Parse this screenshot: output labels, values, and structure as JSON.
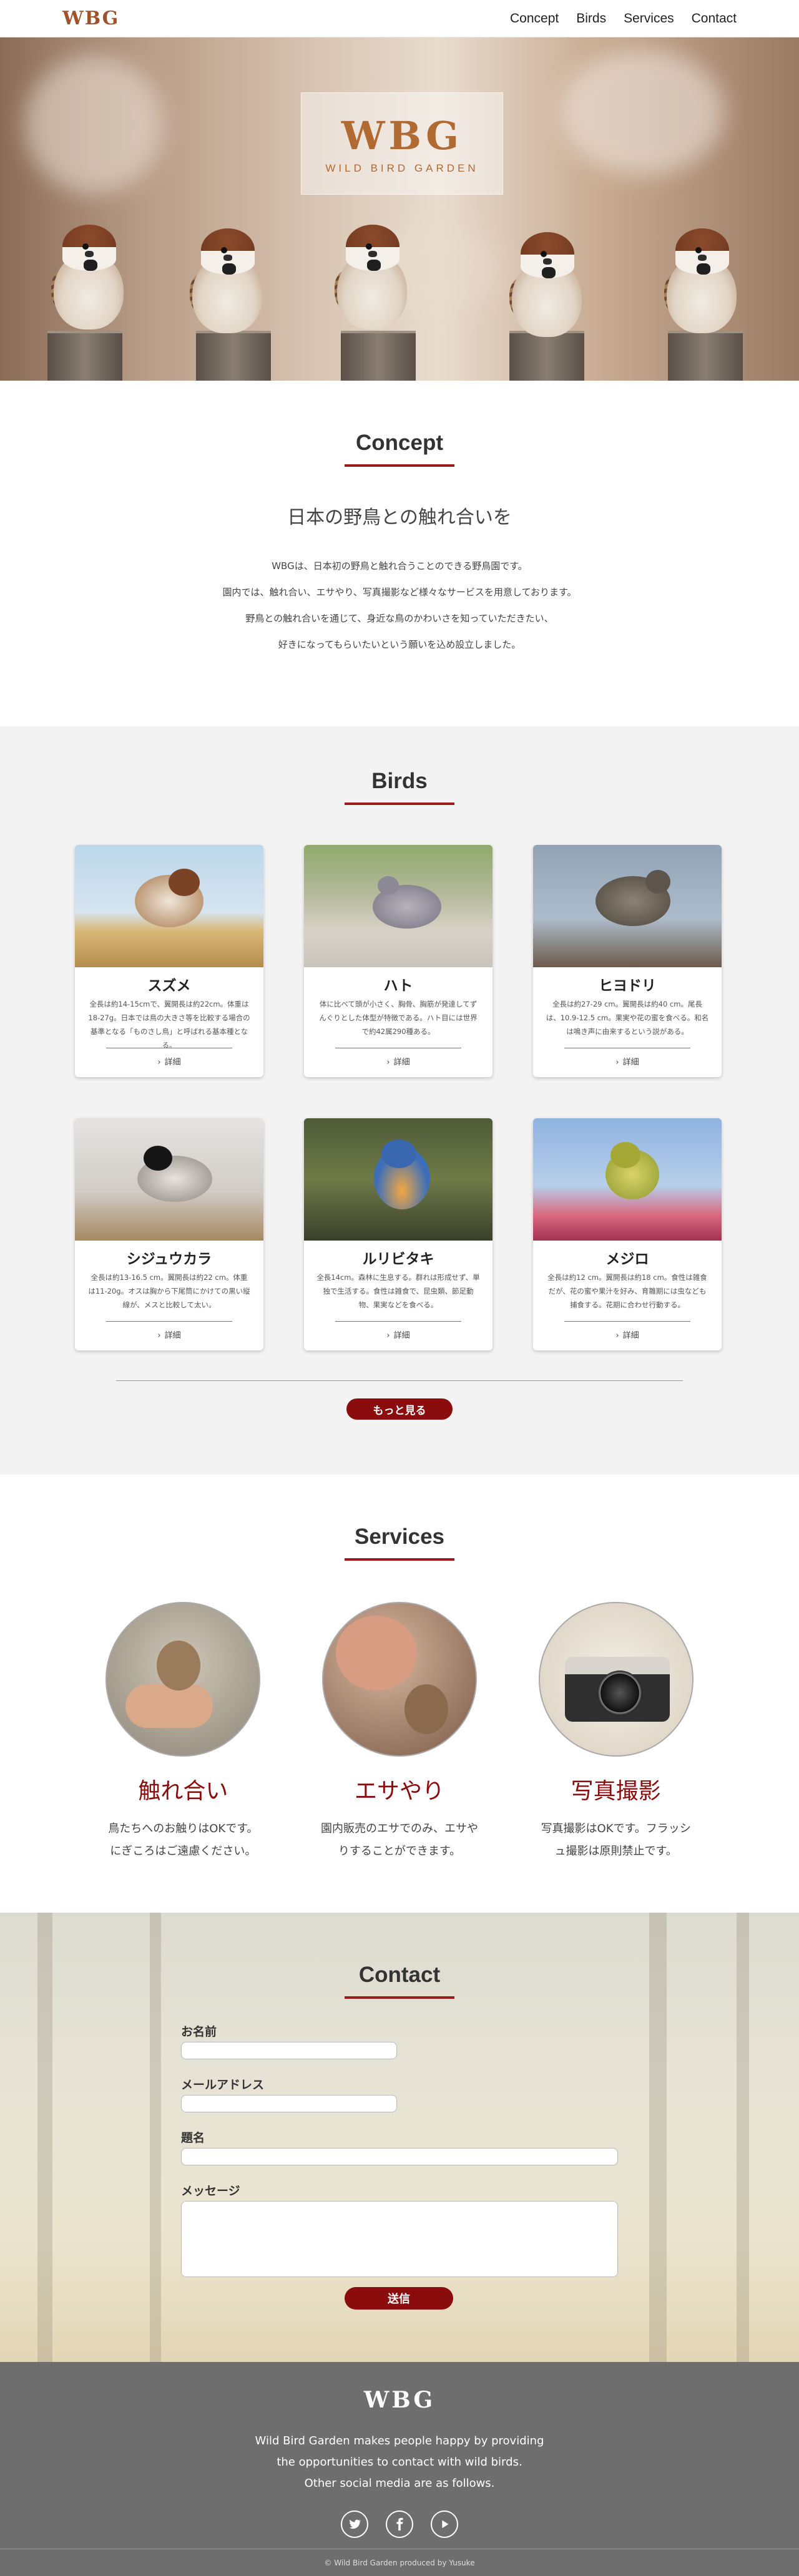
{
  "header": {
    "logo": "WBG",
    "nav": [
      "Concept",
      "Birds",
      "Services",
      "Contact"
    ]
  },
  "hero": {
    "logo": "WBG",
    "subtitle": "WILD BIRD GARDEN"
  },
  "concept": {
    "title": "Concept",
    "heading": "日本の野鳥との触れ合いを",
    "lines": [
      "WBGは、日本初の野鳥と触れ合うことのできる野鳥園です。",
      "園内では、触れ合い、エサやり、写真撮影など様々なサービスを用意しております。",
      "野鳥との触れ合いを通じて、身近な鳥のかわいさを知っていただきたい、",
      "好きになってもらいたいという願いを込め設立しました。"
    ]
  },
  "birds": {
    "title": "Birds",
    "more_label": "詳細",
    "more_button": "もっと見る",
    "cards": [
      {
        "name": "スズメ",
        "desc": "全長は約14-15cmで、翼開長は約22cm。体重は18-27g。日本では鳥の大きさ等を比較する場合の基準となる「ものさし鳥」と呼ばれる基本種となる。"
      },
      {
        "name": "ハト",
        "desc": "体に比べて頭が小さく、胸骨、胸筋が発達してずんぐりとした体型が特徴である。ハト目には世界で約42属290種ある。"
      },
      {
        "name": "ヒヨドリ",
        "desc": "全長は約27-29 cm。翼開長は約40 cm。尾長は、10.9-12.5 cm。果実や花の蜜を食べる。和名は鳴き声に由来するという説がある。"
      },
      {
        "name": "シジュウカラ",
        "desc": "全長は約13-16.5 cm。翼開長は約22 cm。体重は11-20g。オスは胸から下尾筒にかけての黒い縦線が、メスと比較して太い。"
      },
      {
        "name": "ルリビタキ",
        "desc": "全長14cm。森林に生息する。群れは形成せず、単独で生活する。食性は雑食で、昆虫類、節足動物、果実などを食べる。"
      },
      {
        "name": "メジロ",
        "desc": "全長は約12 cm。翼開長は約18 cm。食性は雑食だが、花の蜜や果汁を好み、育雛期には虫なども捕食する。花期に合わせ行動する。"
      }
    ]
  },
  "services": {
    "title": "Services",
    "items": [
      {
        "title": "触れ合い",
        "lines": [
          "鳥たちへのお触りはOKです。",
          "にぎころはご遠慮ください。"
        ]
      },
      {
        "title": "エサやり",
        "lines": [
          "園内販売のエサでのみ、エサや",
          "りすることができます。"
        ]
      },
      {
        "title": "写真撮影",
        "lines": [
          "写真撮影はOKです。フラッシ",
          "ュ撮影は原則禁止です。"
        ]
      }
    ]
  },
  "contact": {
    "title": "Contact",
    "fields": [
      "お名前",
      "メールアドレス",
      "題名",
      "メッセージ"
    ],
    "submit": "送信"
  },
  "footer": {
    "logo": "WBG",
    "lines": [
      "Wild Bird Garden makes people happy  by providing",
      "the opportunities to contact with wild birds.",
      "Other social media are as follows."
    ],
    "credit": "© Wild Bird Garden produced by Yusuke"
  },
  "colors": {
    "accent": "#8b0c0c",
    "brand": "#a0522d",
    "footer_bg": "#6e6e6e"
  }
}
